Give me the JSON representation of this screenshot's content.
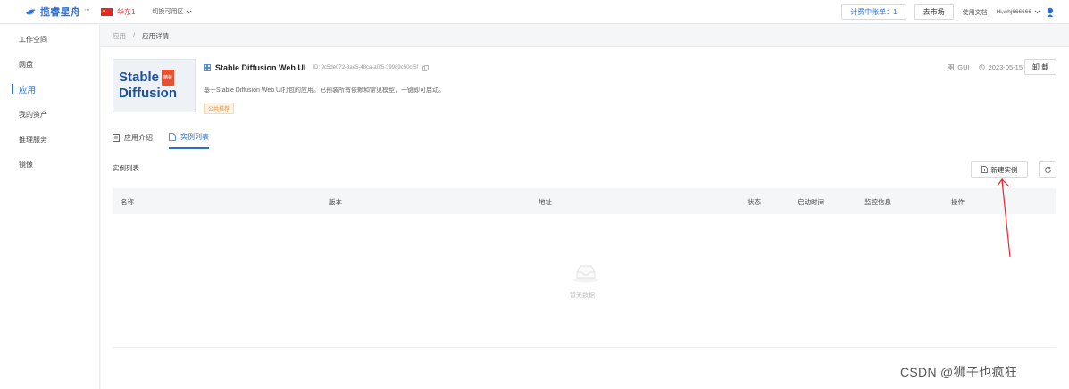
{
  "brand": {
    "name": "揽睿星舟",
    "tm": "™"
  },
  "topbar": {
    "region": "华东1",
    "switch_zone": "切换可用区",
    "bill": "计费中账单：1",
    "market": "去市场",
    "docs": "使用文档",
    "user": "Hi,whj666666"
  },
  "sidebar": {
    "items": [
      {
        "label": "工作空间"
      },
      {
        "label": "网盘"
      },
      {
        "label": "应用"
      },
      {
        "label": "我的资产"
      },
      {
        "label": "推理服务"
      },
      {
        "label": "镜像"
      }
    ]
  },
  "breadcrumb": {
    "root": "应用",
    "sep": "/",
    "current": "应用详情"
  },
  "app": {
    "logo_line1": "Stable",
    "logo_badge": "精装",
    "logo_line2": "Diffusion",
    "title": "Stable Diffusion Web UI",
    "id": "ID: 9c5de072-3ae5-48ca-a0f5-39989c50cf5f",
    "description": "基于Stable Diffusion Web UI打包的应用。已预装所有依赖和常见模型，一键即可启动。",
    "tag": "公共推荐",
    "type": "GUI",
    "date": "2023-05-15",
    "uninstall": "卸 载"
  },
  "tabs": [
    {
      "label": "应用介绍"
    },
    {
      "label": "实例列表"
    }
  ],
  "instances": {
    "title": "实例列表",
    "new_button": "新建实例",
    "columns": [
      "名称",
      "版本",
      "地址",
      "状态",
      "启动时间",
      "监控信息",
      "操作"
    ],
    "rows": [],
    "empty_text": "暂无数据"
  },
  "watermark": "CSDN @狮子也疯狂",
  "colors": {
    "accent": "#2b6fd6",
    "annotation": "#e8242e",
    "tag": "#e8943a"
  }
}
